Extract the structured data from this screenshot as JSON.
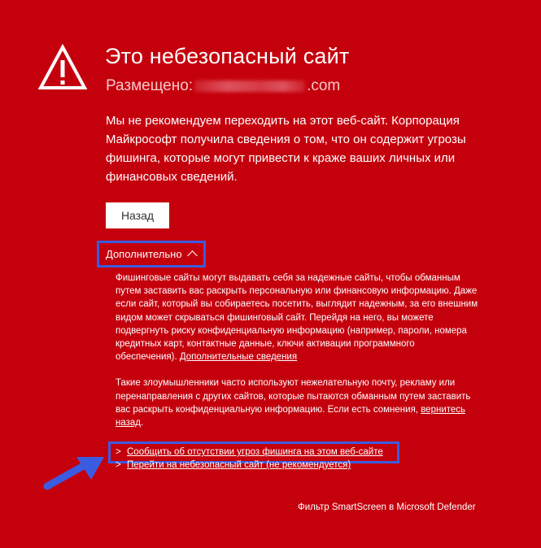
{
  "page": {
    "title": "Это небезопасный сайт",
    "hosted_label": "Размещено:",
    "hosted_domain_suffix": ".com",
    "warning_text": "Мы не рекомендуем переходить на этот веб-сайт. Корпорация Майкрософт получила сведения о том, что он содержит угрозы фишинга, которые могут привести к краже ваших личных или финансовых сведений."
  },
  "buttons": {
    "back_label": "Назад"
  },
  "advanced": {
    "label": "Дополнительно",
    "expanded": true,
    "paragraph1": "Фишинговые сайты могут выдавать себя за надежные сайты, чтобы обманным путем заставить вас раскрыть персональную или финансовую информацию. Даже если сайт, который вы собираетесь посетить, выглядит надежным, за его внешним видом может скрываться фишинговый сайт. Перейдя на него, вы можете подвергнуть риску конфиденциальную информацию (например, пароли, номера кредитных карт, контактные данные, ключи активации программного обеспечения).",
    "more_info_link": "Дополнительные сведения",
    "paragraph2": "Такие злоумышленники часто используют нежелательную почту, рекламу или перенаправления с других сайтов, которые пытаются обманным путем заставить вас раскрыть конфиденциальную информацию. Если есть сомнения,",
    "go_back_link": "вернитесь назад",
    "paragraph2_end": "."
  },
  "links": {
    "caret": ">",
    "report_safe": "Сообщить об отсутствии угроз фишинга на этом веб-сайте",
    "proceed_unsafe": "Перейти на небезопасный сайт (не рекомендуется)"
  },
  "footer": {
    "text": "Фильтр SmartScreen в Microsoft Defender"
  },
  "colors": {
    "background": "#c5000d",
    "text": "#ffffff",
    "hosted_text": "#f6c8cb",
    "highlight": "#3b5ce0",
    "button_bg": "#ffffff",
    "button_text": "#333333"
  },
  "icons": {
    "warning": "warning-triangle-icon",
    "chevron": "chevron-up-icon",
    "annotation_arrow": "arrow-icon"
  }
}
